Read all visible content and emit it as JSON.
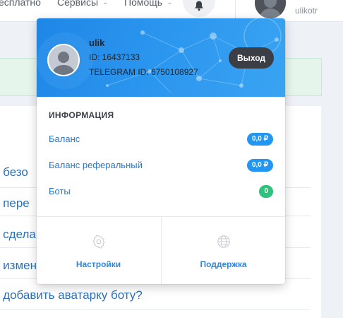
{
  "topbar": {
    "nav": [
      {
        "label": "есплатно"
      },
      {
        "label": "Сервисы"
      },
      {
        "label": "Помощь"
      }
    ],
    "username": "ulikotr"
  },
  "background": {
    "links": [
      "к безо",
      "к пере",
      "к сдела",
      "к измен",
      "к добавить аватарку боту?"
    ]
  },
  "profile": {
    "name": "ulik",
    "id": "ID: 16437133",
    "telegram_id": "TELEGRAM ID: 6750108927",
    "logout_label": "Выход"
  },
  "info": {
    "title": "ИНФОРМАЦИЯ",
    "rows": [
      {
        "label": "Баланс",
        "value": "0,0 ₽",
        "color": "#2196f3"
      },
      {
        "label": "Баланс реферальный",
        "value": "0,0 ₽",
        "color": "#2196f3"
      },
      {
        "label": "Боты",
        "value": "0",
        "color": "#2ec27e"
      }
    ]
  },
  "footer": {
    "settings_label": "Настройки",
    "support_label": "Поддержка"
  }
}
